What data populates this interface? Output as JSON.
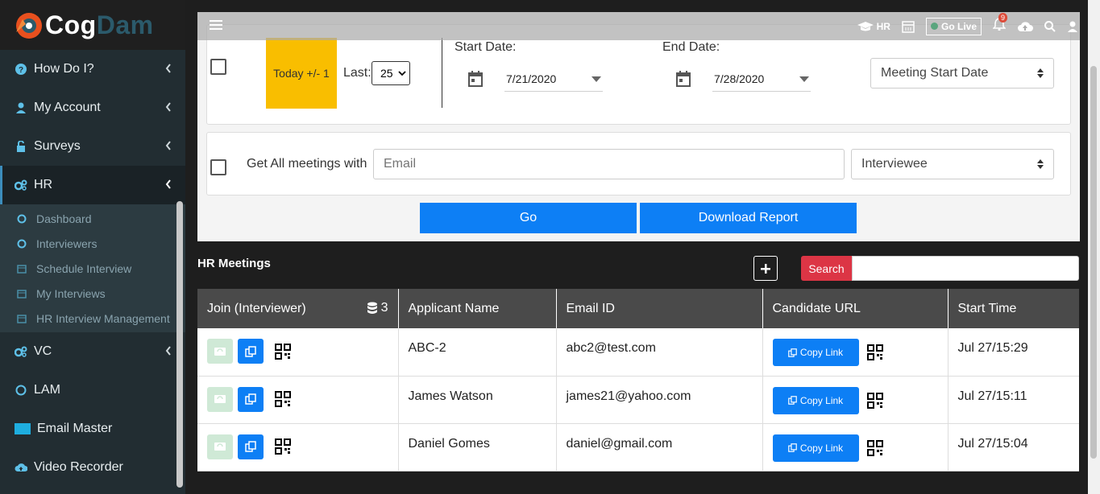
{
  "brand": {
    "name_part1": "Cog",
    "name_part2": "Dam"
  },
  "sidebar": {
    "items": [
      {
        "label": "How Do I?",
        "icon": "question-circle-icon"
      },
      {
        "label": "My Account",
        "icon": "user-icon"
      },
      {
        "label": "Surveys",
        "icon": "unlock-icon"
      },
      {
        "label": "HR",
        "icon": "cogs-icon"
      },
      {
        "label": "VC",
        "icon": "cogs-icon"
      },
      {
        "label": "LAM",
        "icon": "circle-icon"
      },
      {
        "label": "Email Master",
        "icon": "square-icon"
      },
      {
        "label": "Video Recorder",
        "icon": "cloud-upload-icon"
      }
    ],
    "hr_sub": [
      {
        "label": "Dashboard",
        "icon": "circle-icon"
      },
      {
        "label": "Interviewers",
        "icon": "circle-icon"
      },
      {
        "label": "Schedule Interview",
        "icon": "calendar-icon"
      },
      {
        "label": "My Interviews",
        "icon": "calendar-icon"
      },
      {
        "label": "HR Interview Management",
        "icon": "calendar-icon"
      }
    ]
  },
  "topbar": {
    "hr_label": "HR",
    "golive_label": "Go Live",
    "notif_count": "9"
  },
  "filters": {
    "today_label": "Today +/- 1",
    "last_label": "Last:",
    "last_value": "25",
    "start_label": "Start Date:",
    "start_value": "7/21/2020",
    "end_label": "End Date:",
    "end_value": "7/28/2020",
    "date_type": "Meeting Start Date",
    "get_all_label": "Get All meetings with",
    "email_placeholder": "Email",
    "role_value": "Interviewee",
    "go_label": "Go",
    "download_label": "Download Report"
  },
  "meetings": {
    "title": "HR Meetings",
    "search_label": "Search",
    "count": "3",
    "columns": [
      "Join (Interviewer)",
      "Applicant Name",
      "Email ID",
      "Candidate URL",
      "Start Time"
    ],
    "copy_link_label": "Copy Link",
    "rows": [
      {
        "applicant": "ABC-2",
        "email": "abc2@test.com",
        "start": "Jul 27/15:29"
      },
      {
        "applicant": "James Watson",
        "email": "james21@yahoo.com",
        "start": "Jul 27/15:11"
      },
      {
        "applicant": "Daniel Gomes",
        "email": "daniel@gmail.com",
        "start": "Jul 27/15:04"
      }
    ]
  },
  "colors": {
    "accent_blue": "#0d7ff5",
    "today_yellow": "#f9be00",
    "search_red": "#dc3545",
    "sidebar_bg": "#222d32"
  }
}
